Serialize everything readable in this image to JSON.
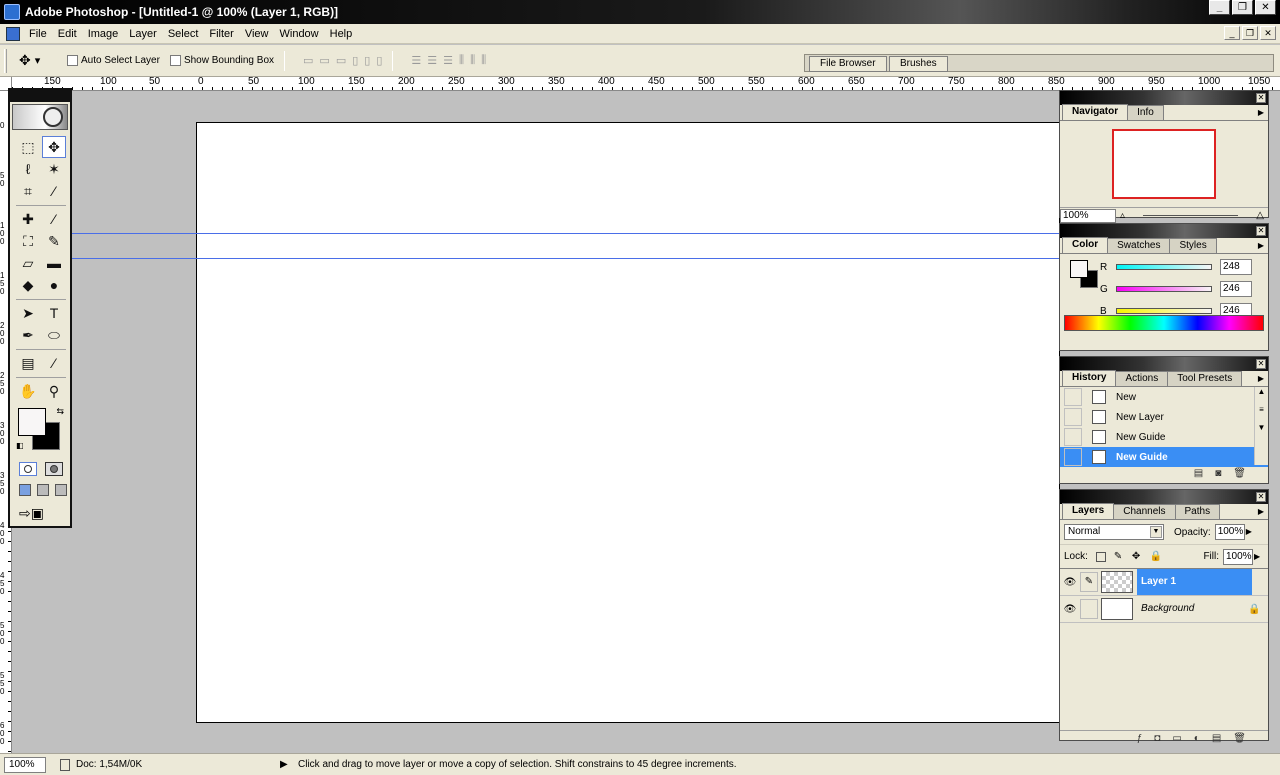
{
  "window": {
    "title": "Adobe Photoshop - [Untitled-1 @ 100% (Layer 1, RGB)]",
    "controls": [
      "_",
      "❐",
      "✕"
    ],
    "mdi_controls": [
      "_",
      "❐",
      "✕"
    ]
  },
  "menu": [
    "File",
    "Edit",
    "Image",
    "Layer",
    "Select",
    "Filter",
    "View",
    "Window",
    "Help"
  ],
  "options": {
    "auto_select": "Auto Select Layer",
    "show_bbox": "Show Bounding Box",
    "align_glyphs": [
      "▭",
      "▭",
      "▭",
      "▯",
      "▯",
      "▯"
    ],
    "distribute_glyphs": [
      "☰",
      "☰",
      "☰",
      "⫼",
      "⫼",
      "⫼"
    ]
  },
  "wells": {
    "file_browser": "File Browser",
    "brushes": "Brushes"
  },
  "ruler": {
    "h_labels": [
      "150",
      "100",
      "50",
      "0",
      "50",
      "100",
      "150",
      "200",
      "250",
      "300",
      "350",
      "400",
      "450",
      "500",
      "550",
      "600",
      "650",
      "700",
      "750",
      "800",
      "850",
      "900",
      "950",
      "1000",
      "1050"
    ],
    "v_labels": [
      "0",
      "50",
      "100",
      "150",
      "200",
      "250",
      "300",
      "350",
      "400",
      "450",
      "500",
      "550",
      "600"
    ]
  },
  "toolbox": {
    "tools": [
      {
        "name": "marquee-tool",
        "glyph": "⬚"
      },
      {
        "name": "move-tool",
        "glyph": "✥"
      },
      {
        "name": "lasso-tool",
        "glyph": "ℓ"
      },
      {
        "name": "magic-wand-tool",
        "glyph": "✶"
      },
      {
        "name": "crop-tool",
        "glyph": "⌗"
      },
      {
        "name": "slice-tool",
        "glyph": "⁄"
      },
      {
        "name": "healing-brush-tool",
        "glyph": "✚"
      },
      {
        "name": "brush-tool",
        "glyph": "⁄"
      },
      {
        "name": "clone-stamp-tool",
        "glyph": "⛶"
      },
      {
        "name": "history-brush-tool",
        "glyph": "✎"
      },
      {
        "name": "eraser-tool",
        "glyph": "▱"
      },
      {
        "name": "gradient-tool",
        "glyph": "▬"
      },
      {
        "name": "blur-tool",
        "glyph": "◆"
      },
      {
        "name": "dodge-tool",
        "glyph": "●"
      },
      {
        "name": "path-select-tool",
        "glyph": "➤"
      },
      {
        "name": "type-tool",
        "glyph": "T"
      },
      {
        "name": "pen-tool",
        "glyph": "✒"
      },
      {
        "name": "shape-tool",
        "glyph": "⬭"
      },
      {
        "name": "notes-tool",
        "glyph": "▤"
      },
      {
        "name": "eyedropper-tool",
        "glyph": "⁄"
      },
      {
        "name": "hand-tool",
        "glyph": "✋"
      },
      {
        "name": "zoom-tool",
        "glyph": "⚲"
      }
    ]
  },
  "navigator": {
    "tab": "Navigator",
    "tab2": "Info",
    "zoom": "100%"
  },
  "color": {
    "tabs": [
      "Color",
      "Swatches",
      "Styles"
    ],
    "channels": [
      {
        "label": "R",
        "value": "248",
        "grad": "linear-gradient(90deg,#00f6f6,#f8f6f6)"
      },
      {
        "label": "G",
        "value": "246",
        "grad": "linear-gradient(90deg,#f800f6,#f8f6f6)"
      },
      {
        "label": "B",
        "value": "246",
        "grad": "linear-gradient(90deg,#f8f600,#f8f6f6)"
      }
    ],
    "foreground": "#f8f6f6",
    "background": "#000000"
  },
  "history": {
    "tabs": [
      "History",
      "Actions",
      "Tool Presets"
    ],
    "items": [
      "New",
      "New Layer",
      "New Guide",
      "New Guide"
    ]
  },
  "layers": {
    "tabs": [
      "Layers",
      "Channels",
      "Paths"
    ],
    "blend_mode": "Normal",
    "opacity_label": "Opacity:",
    "opacity": "100%",
    "lock_label": "Lock:",
    "fill_label": "Fill:",
    "fill": "100%",
    "items": [
      {
        "name": "Layer 1",
        "selected": true
      },
      {
        "name": "Background",
        "selected": false
      }
    ]
  },
  "status": {
    "zoom": "100%",
    "doc": "Doc: 1,54M/0K",
    "hint": "Click and drag to move layer or move a copy of selection. Shift constrains to 45 degree increments."
  }
}
